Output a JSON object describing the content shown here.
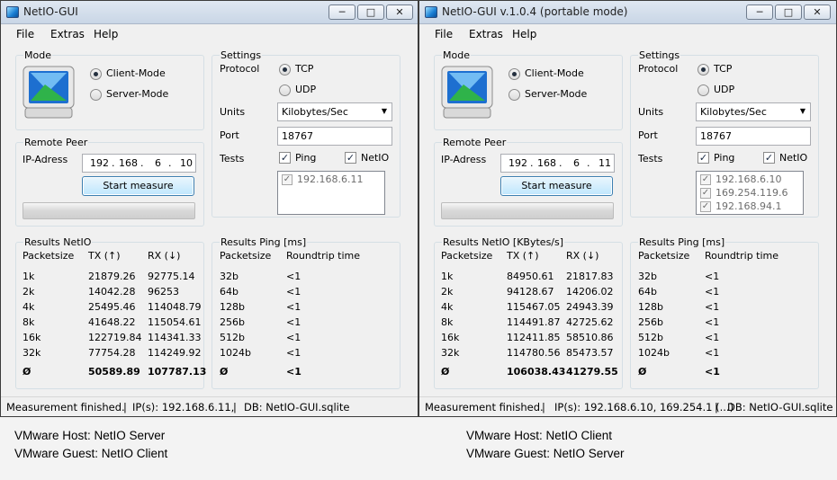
{
  "windows": [
    {
      "title": "NetIO-GUI",
      "menu": [
        "File",
        "Extras",
        "Help"
      ],
      "mode": {
        "title": "Mode",
        "client_label": "Client-Mode",
        "server_label": "Server-Mode",
        "selected": "client"
      },
      "remote_peer": {
        "title": "Remote Peer",
        "ip_label": "IP-Adress",
        "ip": [
          "192",
          "168",
          "6",
          "10"
        ],
        "start_label": "Start measure"
      },
      "settings": {
        "title": "Settings",
        "protocol_label": "Protocol",
        "tcp_label": "TCP",
        "udp_label": "UDP",
        "protocol_selected": "TCP",
        "units_label": "Units",
        "units_value": "Kilobytes/Sec",
        "port_label": "Port",
        "port_value": "18767",
        "tests_label": "Tests",
        "ping_label": "Ping",
        "netio_label": "NetIO",
        "hosts": [
          "192.168.6.11"
        ]
      },
      "results_netio": {
        "title": "Results NetIO",
        "headers": [
          "Packetsize",
          "TX (↑)",
          "RX (↓)"
        ],
        "rows": [
          [
            "1k",
            "21879.26",
            "92775.14"
          ],
          [
            "2k",
            "14042.28",
            "96253"
          ],
          [
            "4k",
            "25495.46",
            "114048.79"
          ],
          [
            "8k",
            "41648.22",
            "115054.61"
          ],
          [
            "16k",
            "122719.84",
            "114341.33"
          ],
          [
            "32k",
            "77754.28",
            "114249.92"
          ]
        ],
        "avg": [
          "Ø",
          "50589.89",
          "107787.13"
        ]
      },
      "results_ping": {
        "title": "Results Ping [ms]",
        "headers": [
          "Packetsize",
          "Roundtrip time"
        ],
        "rows": [
          [
            "32b",
            "<1"
          ],
          [
            "64b",
            "<1"
          ],
          [
            "128b",
            "<1"
          ],
          [
            "256b",
            "<1"
          ],
          [
            "512b",
            "<1"
          ],
          [
            "1024b",
            "<1"
          ]
        ],
        "avg": [
          "Ø",
          "<1"
        ]
      },
      "status": {
        "message": "Measurement finished.",
        "ips": "IP(s): 192.168.6.11,",
        "db": "DB: NetIO-GUI.sqlite"
      }
    },
    {
      "title": "NetIO-GUI v.1.0.4 (portable mode)",
      "menu": [
        "File",
        "Extras",
        "Help"
      ],
      "mode": {
        "title": "Mode",
        "client_label": "Client-Mode",
        "server_label": "Server-Mode",
        "selected": "client"
      },
      "remote_peer": {
        "title": "Remote Peer",
        "ip_label": "IP-Adress",
        "ip": [
          "192",
          "168",
          "6",
          "11"
        ],
        "start_label": "Start measure"
      },
      "settings": {
        "title": "Settings",
        "protocol_label": "Protocol",
        "tcp_label": "TCP",
        "udp_label": "UDP",
        "protocol_selected": "TCP",
        "units_label": "Units",
        "units_value": "Kilobytes/Sec",
        "port_label": "Port",
        "port_value": "18767",
        "tests_label": "Tests",
        "ping_label": "Ping",
        "netio_label": "NetIO",
        "hosts": [
          "192.168.6.10",
          "169.254.119.6",
          "192.168.94.1"
        ]
      },
      "results_netio": {
        "title": "Results NetIO [KBytes/s]",
        "headers": [
          "Packetsize",
          "TX (↑)",
          "RX (↓)"
        ],
        "rows": [
          [
            "1k",
            "84950.61",
            "21817.83"
          ],
          [
            "2k",
            "94128.67",
            "14206.02"
          ],
          [
            "4k",
            "115467.05",
            "24943.39"
          ],
          [
            "8k",
            "114491.87",
            "42725.62"
          ],
          [
            "16k",
            "112411.85",
            "58510.86"
          ],
          [
            "32k",
            "114780.56",
            "85473.57"
          ]
        ],
        "avg": [
          "Ø",
          "106038.43",
          "41279.55"
        ]
      },
      "results_ping": {
        "title": "Results Ping [ms]",
        "headers": [
          "Packetsize",
          "Roundtrip time"
        ],
        "rows": [
          [
            "32b",
            "<1"
          ],
          [
            "64b",
            "<1"
          ],
          [
            "128b",
            "<1"
          ],
          [
            "256b",
            "<1"
          ],
          [
            "512b",
            "<1"
          ],
          [
            "1024b",
            "<1"
          ]
        ],
        "avg": [
          "Ø",
          "<1"
        ]
      },
      "status": {
        "message": "Measurement finished.",
        "ips": "IP(s): 192.168.6.10, 169.254.1 (...)",
        "db": "DB: NetIO-GUI.sqlite"
      }
    }
  ],
  "window_controls": {
    "minimize": "─",
    "maximize": "□",
    "close": "✕"
  },
  "select_arrow": "▼",
  "check_mark": "✓",
  "separator": "|",
  "ip_dot": ".",
  "captions": [
    {
      "host": "VMware Host: NetIO Server",
      "guest": "VMware Guest: NetIO Client"
    },
    {
      "host": "VMware Host: NetIO Client",
      "guest": "VMware Guest: NetIO Server"
    }
  ]
}
